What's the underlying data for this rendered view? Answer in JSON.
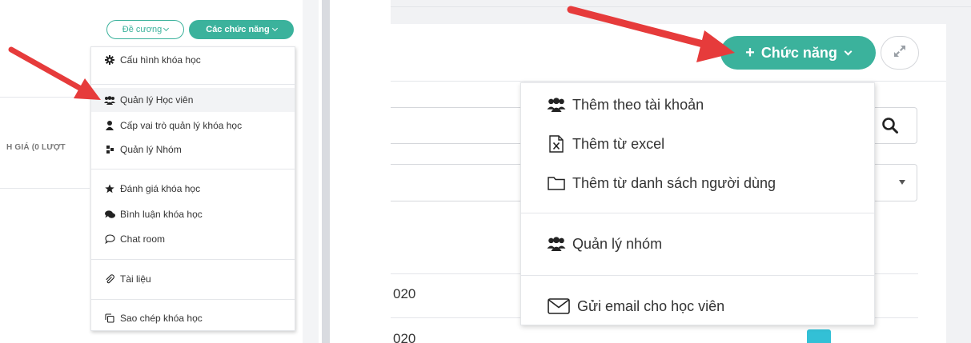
{
  "left": {
    "outline_button_label": "Đề cương",
    "functions_button_label": "Các chức năng",
    "side_label": "H GIÁ (0 LƯỢT",
    "menu": {
      "items": [
        {
          "label": "Cấu hình khóa học",
          "icon": "gear-icon"
        },
        {
          "label": "Quản lý Học viên",
          "icon": "users-icon"
        },
        {
          "label": "Cấp vai trò quản lý khóa học",
          "icon": "user-icon"
        },
        {
          "label": "Quản lý Nhóm",
          "icon": "group-icon"
        },
        {
          "label": "Đánh giá khóa học",
          "icon": "star-icon"
        },
        {
          "label": "Bình luận khóa học",
          "icon": "comments-icon"
        },
        {
          "label": "Chat room",
          "icon": "chat-bubble-icon"
        },
        {
          "label": "Tài liệu",
          "icon": "paperclip-icon"
        },
        {
          "label": "Sao chép khóa học",
          "icon": "copy-icon"
        }
      ]
    }
  },
  "right": {
    "functions_button_label": "Chức năng",
    "row_texts": [
      "020",
      "020"
    ],
    "menu": {
      "items": [
        {
          "label": "Thêm theo tài khoản",
          "icon": "users-icon"
        },
        {
          "label": "Thêm từ excel",
          "icon": "excel-file-icon"
        },
        {
          "label": "Thêm từ danh sách người dùng",
          "icon": "folder-icon"
        },
        {
          "label": "Quản lý nhóm",
          "icon": "users-icon"
        },
        {
          "label": "Gửi email cho học viên",
          "icon": "envelope-icon"
        }
      ]
    }
  },
  "colors": {
    "accent": "#3bb29c",
    "arrow": "#e63b3b",
    "chip": "#33c0d6"
  }
}
